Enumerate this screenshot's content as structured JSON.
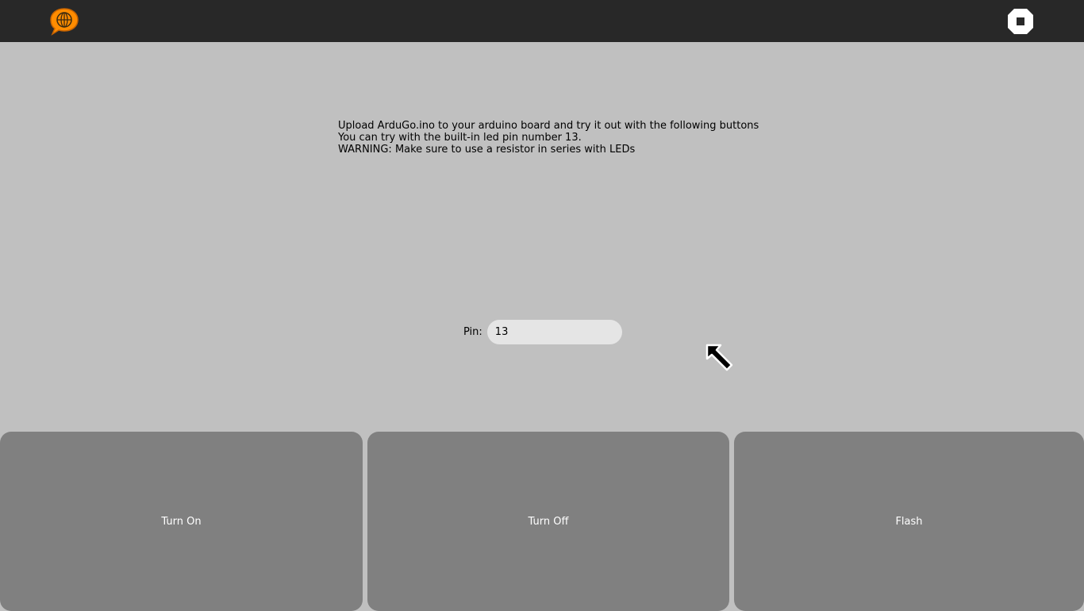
{
  "toolbar": {
    "activity_icon": "activity-globe-speech-bubble-icon",
    "stop_icon": "stop-icon",
    "colors": {
      "background": "#282828",
      "activity_icon": "#ff8c00"
    }
  },
  "instructions": {
    "line1": "Upload ArduGo.ino to your arduino board and try it out with the following buttons",
    "line2": "You can try with the built-in led pin number 13.",
    "line3": "WARNING: Make sure to use a resistor in series with LEDs"
  },
  "pin": {
    "label": "Pin:",
    "value": "13"
  },
  "buttons": {
    "turn_on": "Turn On",
    "turn_off": "Turn Off",
    "flash": "Flash"
  },
  "colors": {
    "canvas": "#c0c0c0",
    "button": "#808080",
    "input": "#e5e5e5"
  }
}
